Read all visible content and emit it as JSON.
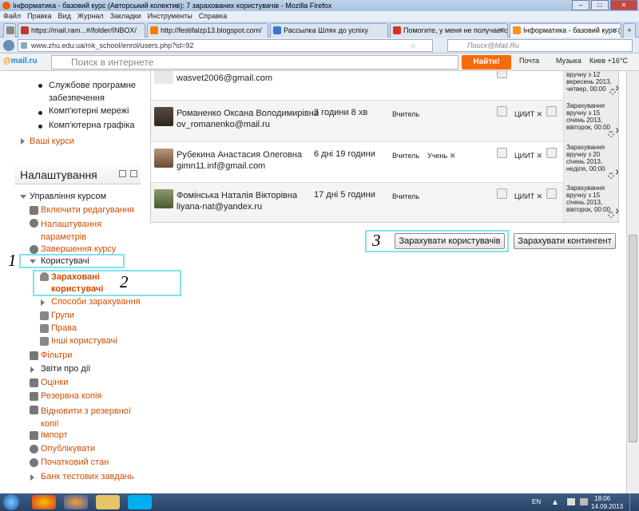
{
  "window": {
    "title": "Інформатика - базовий курс (Авторський колектив): 7 зарахованих користувачів - Mozilla Firefox"
  },
  "menu": [
    "Файл",
    "Правка",
    "Вид",
    "Журнал",
    "Закладки",
    "Инструменты",
    "Справка"
  ],
  "tabs": [
    {
      "label": "https://mail.ram...#/folder/INBOX/",
      "color": "#c0392b"
    },
    {
      "label": "http://festifalzp13.blogspot.com/",
      "color": "#f57d00"
    },
    {
      "label": "Рассылка Шлях до успіху",
      "color": "#3a77c9"
    },
    {
      "label": "Помогите, у меня не получается?...",
      "color": "#d93025"
    },
    {
      "label": "Інформатика - базовий курс (Авт...",
      "color": "#f7941d"
    }
  ],
  "address": {
    "url": "www.zhu.edu.ua/mk_school/enrol/users.php?id=92",
    "search_placeholder": "Поиск@Mail.Ru"
  },
  "mailbar": {
    "logo_prefix": "@",
    "logo_text": "mail.ru",
    "search_placeholder": "Поиск в интернете",
    "find_label": "Найти!",
    "mail_label": "Почта",
    "music_label": "Музыка",
    "weather_label": "Киев +16°С"
  },
  "sidebar": {
    "top_items": [
      "Службове програмне забезпечення",
      "Комп'ютерні мережі",
      "Комп'ютерна графіка"
    ],
    "my_courses": "Ваші курси",
    "settings_header": "Налаштування",
    "course_admin": "Управління курсом",
    "links": {
      "enable_editing": "Включити редагування",
      "edit_settings": "Налаштування параметрів",
      "completion": "Завершення курсу",
      "users": "Користувачі",
      "enrolled_users": "Зараховані користувачі",
      "enrol_methods": "Способи зарахування",
      "groups": "Групи",
      "permissions": "Права",
      "other_users": "Інші користувачі",
      "filters": "Фільтри",
      "reports": "Звіти про дії",
      "grades": "Оцінки",
      "backup": "Резервна копія",
      "restore": "Відновити з резервної копії",
      "import": "Імпорт",
      "publish": "Опублікувати",
      "reset": "Початковий стан",
      "question_bank": "Банк тестових завдань"
    }
  },
  "annotations": [
    "1",
    "2",
    "3"
  ],
  "users": [
    {
      "name": "",
      "email": "wasvet2006@gmail.com",
      "last_access": "",
      "roles": [],
      "groups": [],
      "enrol": "вручну з 12 вересень 2013, четвер, 00:00"
    },
    {
      "name": "Романенко Оксана Володимирівна",
      "email": "ov_romanenko@mail.ru",
      "last_access": "3 години 8 хв",
      "roles": [
        "Вчитель"
      ],
      "groups": [
        "ЦИИТ"
      ],
      "enrol_title": "Зарахування",
      "enrol": "вручну з 15 січень 2013, вівторок, 00:00"
    },
    {
      "name": "Рубекина Анастасия Олеговна",
      "email": "gimn11.inf@gmail.com",
      "last_access": "6 дні 19 години",
      "roles": [
        "Вчитель",
        "Учень"
      ],
      "groups": [
        "ЦИИТ"
      ],
      "enrol_title": "Зарахування",
      "enrol": "вручну з 20 січень 2013, неділя, 00:00"
    },
    {
      "name": "Фомінська Наталія Вікторівна",
      "email": "liyana-nat@yandex.ru",
      "last_access": "17 дні 5 години",
      "roles": [
        "Вчитель"
      ],
      "groups": [
        "ЦИИТ"
      ],
      "enrol_title": "Зарахування",
      "enrol": "вручну з 15 січень 2013, вівторок, 00:00"
    }
  ],
  "buttons": {
    "enrol_users": "Зарахувати користувачів",
    "enrol_cohort": "Зарахувати контингент"
  },
  "taskbar": {
    "lang": "EN",
    "time": "18:06",
    "date": "14.09.2013"
  }
}
